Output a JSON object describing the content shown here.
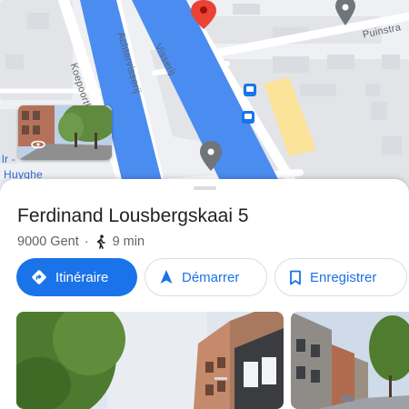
{
  "map": {
    "street_labels": [
      "Koepoortk",
      "Achtervisserij",
      "Visserij",
      "Puinstra"
    ],
    "fragment_labels": [
      "lr -",
      "Huyghe"
    ],
    "colors": {
      "water": "#4a8cf0",
      "pin": "#ea4335",
      "land": "#eef0f3",
      "poi_pin": "#70757a"
    }
  },
  "place": {
    "name": "Ferdinand Lousbergskaai 5",
    "postcode_city": "9000 Gent",
    "separator": "·",
    "walk_time": "9 min"
  },
  "actions": {
    "directions": "Itinéraire",
    "start": "Démarrer",
    "save": "Enregistrer"
  },
  "accent_color": "#1a73e8",
  "icons": [
    "directions-icon",
    "navigation-arrow-icon",
    "bookmark-icon",
    "walking-icon",
    "bus-stop-icon",
    "location-pin-icon",
    "street-view-icon"
  ]
}
